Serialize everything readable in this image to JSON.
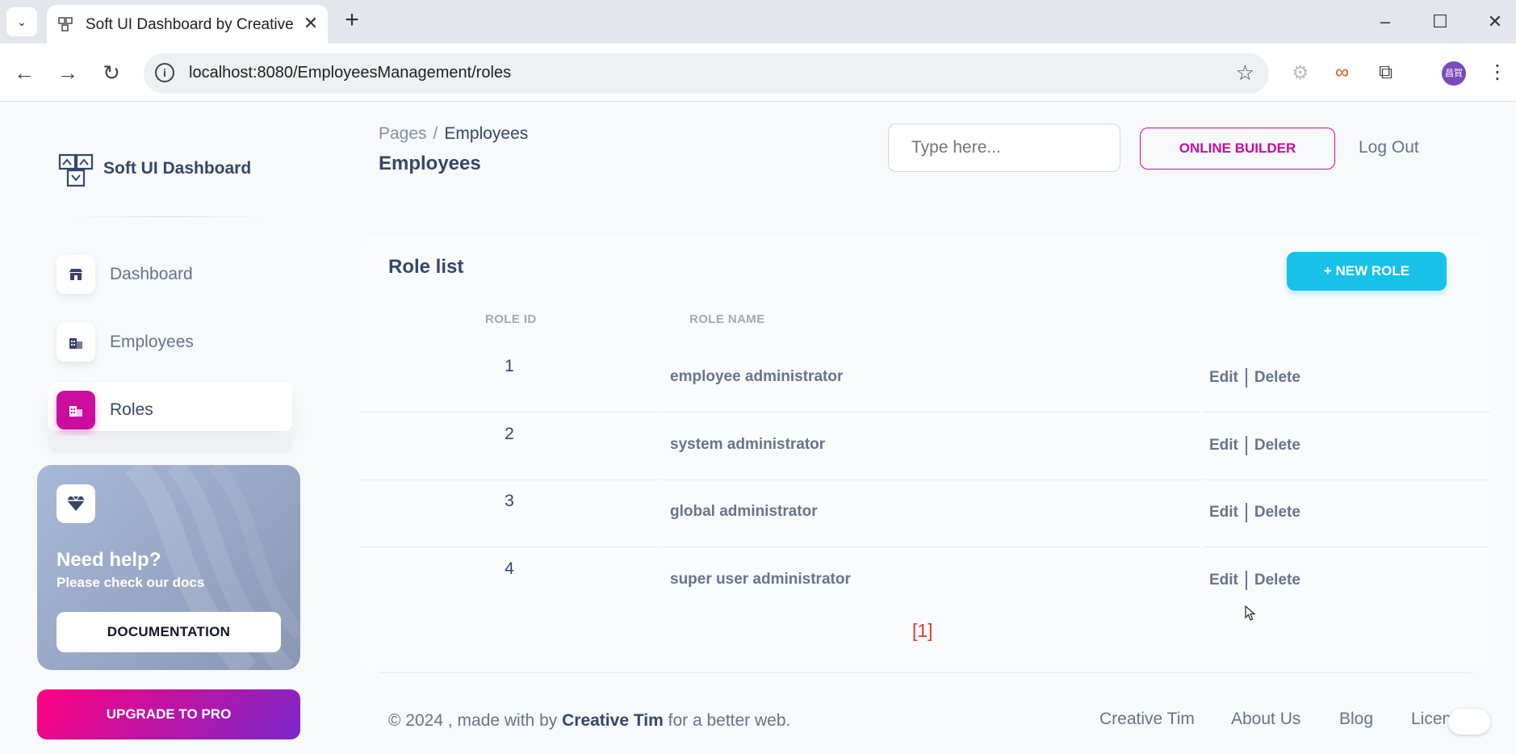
{
  "browser": {
    "tab_title": "Soft UI Dashboard by Creative T",
    "url": "localhost:8080/EmployeesManagement/roles",
    "profile_initials": "昌賀"
  },
  "sidebar": {
    "brand": "Soft UI Dashboard",
    "items": [
      {
        "label": "Dashboard",
        "icon": "shop-icon",
        "active": false
      },
      {
        "label": "Employees",
        "icon": "office-icon",
        "active": false
      },
      {
        "label": "Roles",
        "icon": "office-icon",
        "active": true
      }
    ],
    "help": {
      "title": "Need help?",
      "subtitle": "Please check our docs",
      "button": "DOCUMENTATION"
    },
    "upgrade": "UPGRADE TO PRO"
  },
  "header": {
    "breadcrumb_root": "Pages",
    "breadcrumb_sep": "/",
    "breadcrumb_current": "Employees",
    "title": "Employees",
    "search_placeholder": "Type here...",
    "online_builder": "ONLINE BUILDER",
    "logout": "Log Out"
  },
  "card": {
    "title": "Role list",
    "new_button": "+ NEW ROLE",
    "columns": [
      "ROLE ID",
      "ROLE NAME"
    ],
    "rows": [
      {
        "id": "1",
        "name": "employee administrator"
      },
      {
        "id": "2",
        "name": "system administrator"
      },
      {
        "id": "3",
        "name": "global administrator"
      },
      {
        "id": "4",
        "name": "super user administrator"
      }
    ],
    "edit_label": "Edit",
    "delete_label": "Delete",
    "pagination": "[1]"
  },
  "footer": {
    "copy_prefix": "© 2024 , made with by",
    "copy_brand": "Creative Tim",
    "copy_suffix": "for a better web.",
    "links": [
      "Creative Tim",
      "About Us",
      "Blog",
      "Licen"
    ]
  },
  "colors": {
    "primary": "#cb0c9f",
    "info": "#17c1e8",
    "text_dark": "#344767",
    "text_muted": "#67748e",
    "pager_red": "#e53935"
  }
}
